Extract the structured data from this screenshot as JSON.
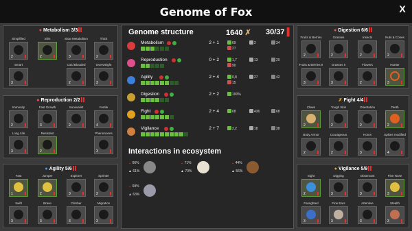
{
  "window": {
    "title": "Genome of Fox",
    "close_label": "X"
  },
  "panels": {
    "metabolism": {
      "title": "Metabolism",
      "count": "3/3",
      "skills": [
        {
          "label": "Simplified",
          "n": "2"
        },
        {
          "label": "Slim",
          "n": "2"
        },
        {
          "label": "Slow Metabolism",
          "n": "3"
        },
        {
          "label": "Thick",
          "n": "2"
        },
        {
          "label": "Smart",
          "n": "3"
        },
        {
          "label": "Cold Blooded",
          "n": "2"
        },
        {
          "label": "Overweight",
          "n": "3"
        }
      ]
    },
    "reproduction": {
      "title": "Reproduction",
      "count": "2/2",
      "skills": [
        {
          "label": "Immunity",
          "n": "2"
        },
        {
          "label": "Fast Growth",
          "n": "3"
        },
        {
          "label": "Survivalist",
          "n": "2"
        },
        {
          "label": "Fertile",
          "n": "4"
        },
        {
          "label": "Long Life",
          "n": "3"
        },
        {
          "label": "Resistant",
          "n": "2"
        },
        {
          "label": "Pheromones",
          "n": "3"
        }
      ]
    },
    "agility": {
      "title": "Agility",
      "count": "5/6",
      "skills": [
        {
          "label": "Fast",
          "n": "1"
        },
        {
          "label": "Jumper",
          "n": "2"
        },
        {
          "label": "Explorer",
          "n": "3"
        },
        {
          "label": "Sprinter",
          "n": "2"
        },
        {
          "label": "Swift",
          "n": "3"
        },
        {
          "label": "Brave",
          "n": "3"
        },
        {
          "label": "Climber",
          "n": "3"
        },
        {
          "label": "Migration",
          "n": "3"
        }
      ]
    },
    "digestion": {
      "title": "Digestion",
      "count": "6/6",
      "skills": [
        {
          "label": "Fruits & Berries",
          "n": "2"
        },
        {
          "label": "Grasses",
          "n": "2"
        },
        {
          "label": "Insects",
          "n": "2"
        },
        {
          "label": "Nuts & Cones",
          "n": "2"
        },
        {
          "label": "Fruits & Berries II",
          "n": "3"
        },
        {
          "label": "Grasses II",
          "n": "3"
        },
        {
          "label": "Flowers",
          "n": "2"
        },
        {
          "label": "Hunter",
          "n": "3"
        }
      ]
    },
    "fight": {
      "title": "Fight",
      "count": "4/4",
      "skills": [
        {
          "label": "Claws",
          "n": "2"
        },
        {
          "label": "Tough Skin",
          "n": "2"
        },
        {
          "label": "Orientation",
          "n": "2"
        },
        {
          "label": "Teeth",
          "n": "2"
        },
        {
          "label": "Body Armor",
          "n": "2"
        },
        {
          "label": "Courageous",
          "n": "2"
        },
        {
          "label": "Horns",
          "n": "3"
        },
        {
          "label": "Spikes modified",
          "n": "4"
        }
      ]
    },
    "vigilance": {
      "title": "Vigilance",
      "count": "5/9",
      "skills": [
        {
          "label": "Sight",
          "n": "2"
        },
        {
          "label": "Digging",
          "n": "3"
        },
        {
          "label": "Observant",
          "n": "3"
        },
        {
          "label": "Fine Nose",
          "n": "3"
        },
        {
          "label": "Farsighted",
          "n": "3"
        },
        {
          "label": "Fine Ears",
          "n": "3"
        },
        {
          "label": "Attentive",
          "n": "3"
        },
        {
          "label": "Stealth",
          "n": "3"
        }
      ]
    }
  },
  "genome": {
    "title": "Genome structure",
    "points": "1640",
    "genes": "30/37",
    "stats": [
      {
        "name": "Metabolism",
        "val": "2 + 1",
        "filled": 3,
        "total": 6,
        "color": "#d83c3c",
        "effects": [
          "69",
          "2",
          "34",
          "27"
        ]
      },
      {
        "name": "Reproduction",
        "val": "0 + 2",
        "filled": 2,
        "total": 5,
        "color": "#e04e8c",
        "effects": [
          "1,7",
          "13",
          "20",
          "90"
        ]
      },
      {
        "name": "Agility",
        "val": "2 + 4",
        "filled": 6,
        "total": 8,
        "color": "#3c7fd8",
        "effects": [
          "0,8",
          "27",
          "42",
          "15"
        ]
      },
      {
        "name": "Digestion",
        "val": "2 + 2",
        "filled": 4,
        "total": 6,
        "color": "#c8a030",
        "effects": [
          "100%"
        ]
      },
      {
        "name": "Fight",
        "val": "2 + 4",
        "filled": 6,
        "total": 7,
        "color": "#e0a020",
        "effects": [
          "68",
          "436",
          "68"
        ]
      },
      {
        "name": "Vigilance",
        "val": "2 + 7",
        "filled": 9,
        "total": 10,
        "color": "#d08040",
        "effects": [
          "2,2",
          "18",
          "38"
        ]
      }
    ]
  },
  "interactions": {
    "title": "Interactions in ecosystem",
    "items": [
      {
        "a": "66%",
        "b": "61%",
        "animal": "raccoon"
      },
      {
        "a": "71%",
        "b": "70%",
        "animal": "chicken"
      },
      {
        "a": "44%",
        "b": "56%",
        "animal": "hedgehog"
      },
      {
        "a": "69%",
        "b": "63%",
        "animal": "mouse"
      }
    ]
  }
}
